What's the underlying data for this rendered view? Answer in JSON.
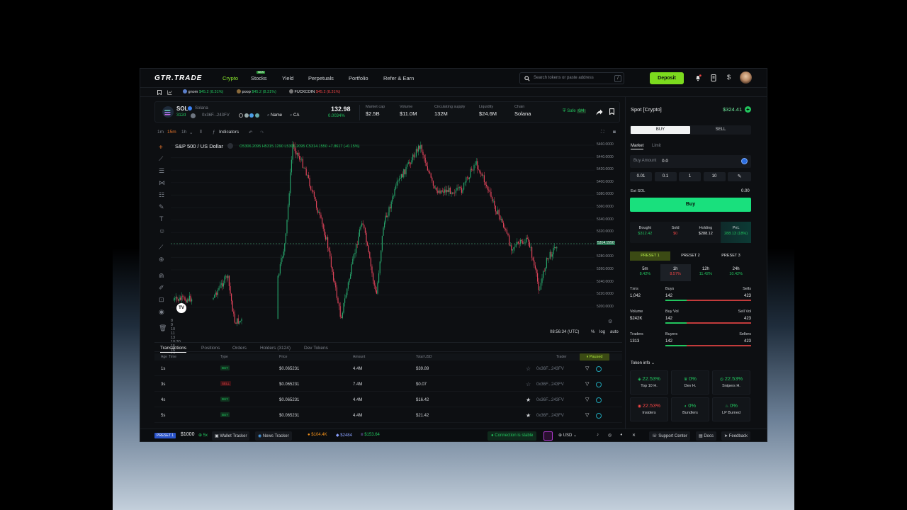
{
  "nav": {
    "logo": "GTR.TRADE",
    "items": [
      "Crypto",
      "Stocks",
      "Yield",
      "Perpetuals",
      "Portfolio",
      "Refer & Earn"
    ],
    "new_badge": "NEW",
    "search_placeholder": "Search tokens or paste address",
    "search_shortcut": "/",
    "deposit": "Deposit"
  },
  "ticker": [
    {
      "name": "gnom",
      "value": "$45.2 (8.31%)"
    },
    {
      "name": "poop",
      "value": "$45.2 (8.31%)"
    },
    {
      "name": "FUCKCOIN",
      "value": "$45.2 (8.31%)"
    }
  ],
  "token": {
    "symbol": "SOL",
    "name": "Solana",
    "age": "312d",
    "address": "0x36F...243FV",
    "tags": [
      "Name",
      "CA"
    ],
    "price": "132.98",
    "change": "0.0034%",
    "stats": [
      {
        "label": "Market cap",
        "value": "$2.5B"
      },
      {
        "label": "Volume",
        "value": "$11.0M"
      },
      {
        "label": "Circulating supply",
        "value": "132M"
      },
      {
        "label": "Liquidity",
        "value": "$24.6M"
      },
      {
        "label": "Chain",
        "value": "Solana"
      }
    ],
    "safe": "Safe",
    "safe_count": "0/4"
  },
  "chart_toolbar": {
    "intervals": [
      "1m",
      "15m",
      "1h"
    ],
    "active_interval": "15m",
    "indicators": "Indicators"
  },
  "chart": {
    "symbol": "S&P 500 / US Dollar",
    "ohlc": {
      "o": "O5306.2095",
      "h": "H5315.1290",
      "l": "L5306.2095",
      "c": "C5314.1550",
      "chg": "+7.8617 (+0.15%)"
    },
    "price_axis": [
      "5460.0000",
      "5440.0000",
      "5420.0000",
      "5400.0000",
      "5380.0000",
      "5360.0000",
      "5340.0000",
      "5320.0000",
      "5300.0000",
      "5280.0000",
      "5260.0000",
      "5240.0000",
      "5220.0000",
      "5200.0000"
    ],
    "current_price": "5314.1550",
    "time_axis": [
      "8",
      "9",
      "10",
      "11",
      "13",
      "10:30",
      "15",
      "16",
      "17",
      "09:00"
    ],
    "time": "08:56:34 (UTC)",
    "pct": "%",
    "log": "log",
    "auto": "auto"
  },
  "tabs": {
    "items": [
      "Transactions",
      "Positions",
      "Orders",
      "Holders (3124)",
      "Dev Tokens"
    ],
    "paused": "Paused"
  },
  "table": {
    "headers": [
      "Age",
      "Time",
      "Type",
      "Price",
      "Amount",
      "Total USD",
      "Trader"
    ],
    "rows": [
      {
        "age": "1s",
        "type": "BUY",
        "price": "$0.065231",
        "amount": "4.4M",
        "total": "$39.89",
        "trader": "0x36F...243FV"
      },
      {
        "age": "3s",
        "type": "SELL",
        "price": "$0.065231",
        "amount": "7.4M",
        "total": "$0.07",
        "trader": "0x36F...243FV"
      },
      {
        "age": "4s",
        "type": "BUY",
        "price": "$0.065231",
        "amount": "4.4M",
        "total": "$16.42",
        "trader": "0x36F...243FV"
      },
      {
        "age": "5s",
        "type": "BUY",
        "price": "$0.065231",
        "amount": "4.4M",
        "total": "$21.42",
        "trader": "0x36F...243FV"
      }
    ]
  },
  "bottom": {
    "preset": "PRESET 1",
    "amount": "$1000",
    "mult": "5x",
    "wallet_tracker": "Wallet Tracker",
    "news_tracker": "News Tracker",
    "btc": "$104.4K",
    "eth": "$2484",
    "sol": "$153.64",
    "connection": "Connection is stable",
    "currency": "USD",
    "support": "Support Center",
    "docs": "Docs",
    "feedback": "Feedback"
  },
  "trade": {
    "title": "Spot [Crypto]",
    "balance": "$324.41",
    "buy": "BUY",
    "sell": "SELL",
    "market": "Market",
    "limit": "Limit",
    "buy_amount_label": "Buy Amount",
    "buy_amount_value": "0.0",
    "quick": [
      "0.01",
      "0.1",
      "1",
      "10"
    ],
    "est_label": "Est SOL",
    "est_value": "0.00",
    "buy_button": "Buy",
    "stats": [
      {
        "label": "Bought",
        "value": "$312.42"
      },
      {
        "label": "Sold",
        "value": "$0"
      },
      {
        "label": "Holding",
        "value": "$288.12"
      },
      {
        "label": "PnL",
        "value": "288.13 (18%)"
      }
    ],
    "presets": [
      "PRESET 1",
      "PRESET 2",
      "PRESET 3"
    ],
    "periods": [
      {
        "label": "5m",
        "value": "8.42%"
      },
      {
        "label": "1h",
        "value": "8.57%"
      },
      {
        "label": "12h",
        "value": "11.42%"
      },
      {
        "label": "24h",
        "value": "10.42%"
      }
    ],
    "flows": [
      {
        "l1": "Txns",
        "v1": "1,042",
        "a": "Buys",
        "b": "Sells",
        "av": "142",
        "bv": "423"
      },
      {
        "l1": "Volume",
        "v1": "$242K",
        "a": "Buy Vol",
        "b": "Sell Vol",
        "av": "142",
        "bv": "423"
      },
      {
        "l1": "Traders",
        "v1": "1313",
        "a": "Buyers",
        "b": "Sellers",
        "av": "142",
        "bv": "423"
      }
    ],
    "token_info": "Token info",
    "info": [
      {
        "value": "22.53%",
        "label": "Top 10 H."
      },
      {
        "value": "0%",
        "label": "Dev H."
      },
      {
        "value": "22.53%",
        "label": "Snipers H."
      },
      {
        "value": "22.53%",
        "label": "Insiders"
      },
      {
        "value": "0%",
        "label": "Bundlers"
      },
      {
        "value": "0%",
        "label": "LP Burned"
      }
    ]
  },
  "colors": {
    "accent": "#8bea2e",
    "buy": "#22c55e",
    "sell": "#ef4444",
    "buy_button": "#19e07d"
  }
}
